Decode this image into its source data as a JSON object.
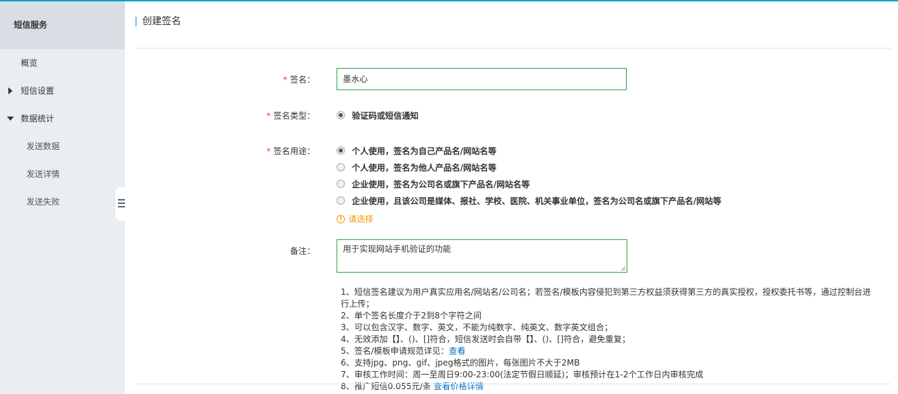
{
  "sidebar": {
    "title": "短信服务",
    "items": [
      {
        "label": "概览"
      },
      {
        "label": "短信设置"
      },
      {
        "label": "数据统计"
      },
      {
        "label": "发送数据"
      },
      {
        "label": "发送详情"
      },
      {
        "label": "发送失败"
      }
    ]
  },
  "page": {
    "title": "创建签名"
  },
  "form": {
    "required_mark": "*",
    "signature": {
      "label": "签名：",
      "value": "墨水心"
    },
    "signature_type": {
      "label": "签名类型：",
      "option": "验证码或短信通知"
    },
    "usage": {
      "label": "签名用途：",
      "options": [
        "个人使用，签名为自己产品名/网站名等",
        "个人使用，签名为他人产品名/网站名等",
        "企业使用，签名为公司名或旗下产品名/网站名等",
        "企业使用，且该公司是媒体、报社、学校、医院、机关事业单位，签名为公司名或旗下产品名/网站等"
      ],
      "warning": "请选择"
    },
    "remark": {
      "label": "备注：",
      "value": "用于实现网站手机验证的功能"
    }
  },
  "notes": {
    "n1": "1、短信签名建议为用户真实应用名/网站名/公司名；若签名/模板内容侵犯到第三方权益须获得第三方的真实授权，授权委托书等，通过控制台进行上传；",
    "n2": "2、单个签名长度介于2到8个字符之间",
    "n3": "3、可以包含汉字、数字、英文，不能为纯数字、纯英文、数字英文组合；",
    "n4": "4、无效添加【】、()、[]符合，短信发送时会自带【】、()、[]符合，避免重复；",
    "n5": "5、签名/模板申请规范详见：",
    "n5_link": "查看",
    "n6": "6、支持jpg、png、gif、jpeg格式的图片，每张图片不大于2MB",
    "n7": "7、审核工作时间：周一至周日9:00-23:00(法定节假日顺延)；审核预计在1-2个工作日内审核完成",
    "n8": "8、推广短信0.055元/条",
    "n8_link": "查看价格详情"
  },
  "colors": {
    "accent": "#2ba245",
    "link": "#0070c0",
    "warning": "#f39800",
    "required": "#e4393c"
  }
}
